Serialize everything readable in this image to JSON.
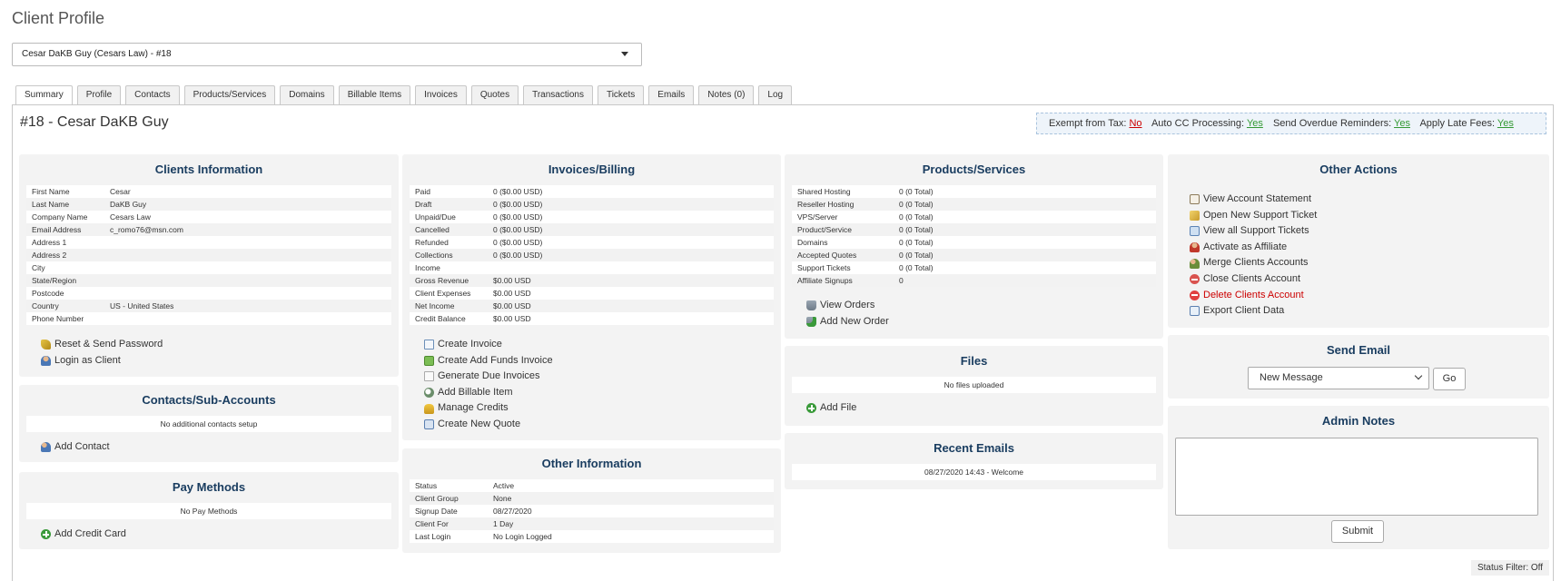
{
  "page": {
    "title": "Client Profile"
  },
  "client_selector": {
    "value": "Cesar DaKB Guy (Cesars Law) - #18"
  },
  "tabs": [
    {
      "label": "Summary",
      "active": true
    },
    {
      "label": "Profile"
    },
    {
      "label": "Contacts"
    },
    {
      "label": "Products/Services"
    },
    {
      "label": "Domains"
    },
    {
      "label": "Billable Items"
    },
    {
      "label": "Invoices"
    },
    {
      "label": "Quotes"
    },
    {
      "label": "Transactions"
    },
    {
      "label": "Tickets"
    },
    {
      "label": "Emails"
    },
    {
      "label": "Notes (0)"
    },
    {
      "label": "Log"
    }
  ],
  "client_heading": "#18 - Cesar DaKB Guy",
  "flags": {
    "exempt_label": "Exempt from Tax:",
    "exempt_value": "No",
    "autocc_label": "Auto CC Processing:",
    "autocc_value": "Yes",
    "overdue_label": "Send Overdue Reminders:",
    "overdue_value": "Yes",
    "latefees_label": "Apply Late Fees:",
    "latefees_value": "Yes"
  },
  "clients_info": {
    "title": "Clients Information",
    "rows": [
      {
        "k": "First Name",
        "v": "Cesar"
      },
      {
        "k": "Last Name",
        "v": "DaKB Guy"
      },
      {
        "k": "Company Name",
        "v": "Cesars Law"
      },
      {
        "k": "Email Address",
        "v": "c_romo76@msn.com"
      },
      {
        "k": "Address 1",
        "v": ""
      },
      {
        "k": "Address 2",
        "v": ""
      },
      {
        "k": "City",
        "v": ""
      },
      {
        "k": "State/Region",
        "v": ""
      },
      {
        "k": "Postcode",
        "v": ""
      },
      {
        "k": "Country",
        "v": "US - United States"
      },
      {
        "k": "Phone Number",
        "v": ""
      }
    ],
    "links": {
      "reset": "Reset & Send Password",
      "login": "Login as Client"
    }
  },
  "contacts": {
    "title": "Contacts/Sub-Accounts",
    "empty": "No additional contacts setup",
    "add": "Add Contact"
  },
  "pay_methods": {
    "title": "Pay Methods",
    "empty": "No Pay Methods",
    "add": "Add Credit Card"
  },
  "invoices": {
    "title": "Invoices/Billing",
    "rows": [
      {
        "k": "Paid",
        "v": "0 ($0.00 USD)"
      },
      {
        "k": "Draft",
        "v": "0 ($0.00 USD)"
      },
      {
        "k": "Unpaid/Due",
        "v": "0 ($0.00 USD)"
      },
      {
        "k": "Cancelled",
        "v": "0 ($0.00 USD)"
      },
      {
        "k": "Refunded",
        "v": "0 ($0.00 USD)"
      },
      {
        "k": "Collections",
        "v": "0 ($0.00 USD)"
      },
      {
        "k": "Income",
        "v": ""
      },
      {
        "k": "Gross Revenue",
        "v": "$0.00 USD"
      },
      {
        "k": "Client Expenses",
        "v": "$0.00 USD"
      },
      {
        "k": "Net Income",
        "v": "$0.00 USD"
      },
      {
        "k": "Credit Balance",
        "v": "$0.00 USD"
      }
    ],
    "links": {
      "create_invoice": "Create Invoice",
      "add_funds": "Create Add Funds Invoice",
      "generate_due": "Generate Due Invoices",
      "billable": "Add Billable Item",
      "credits": "Manage Credits",
      "quote": "Create New Quote"
    }
  },
  "other_info": {
    "title": "Other Information",
    "rows": [
      {
        "k": "Status",
        "v": "Active"
      },
      {
        "k": "Client Group",
        "v": "None"
      },
      {
        "k": "Signup Date",
        "v": "08/27/2020"
      },
      {
        "k": "Client For",
        "v": "1 Day"
      },
      {
        "k": "Last Login",
        "v": "No Login Logged"
      }
    ]
  },
  "products": {
    "title": "Products/Services",
    "rows": [
      {
        "k": "Shared Hosting",
        "v": "0 (0 Total)"
      },
      {
        "k": "Reseller Hosting",
        "v": "0 (0 Total)"
      },
      {
        "k": "VPS/Server",
        "v": "0 (0 Total)"
      },
      {
        "k": "Product/Service",
        "v": "0 (0 Total)"
      },
      {
        "k": "Domains",
        "v": "0 (0 Total)"
      },
      {
        "k": "Accepted Quotes",
        "v": "0 (0 Total)"
      },
      {
        "k": "Support Tickets",
        "v": "0 (0 Total)"
      },
      {
        "k": "Affiliate Signups",
        "v": "0"
      }
    ],
    "links": {
      "view_orders": "View Orders",
      "add_order": "Add New Order"
    }
  },
  "files": {
    "title": "Files",
    "empty": "No files uploaded",
    "add": "Add File"
  },
  "recent_emails": {
    "title": "Recent Emails",
    "item": "08/27/2020 14:43 - Welcome"
  },
  "other_actions": {
    "title": "Other Actions",
    "links": {
      "statement": "View Account Statement",
      "new_ticket": "Open New Support Ticket",
      "all_tickets": "View all Support Tickets",
      "affiliate": "Activate as Affiliate",
      "merge": "Merge Clients Accounts",
      "close": "Close Clients Account",
      "delete": "Delete Clients Account",
      "export": "Export Client Data"
    }
  },
  "send_email": {
    "title": "Send Email",
    "selected": "New Message",
    "go": "Go"
  },
  "admin_notes": {
    "title": "Admin Notes",
    "submit": "Submit"
  },
  "status_filter": "Status Filter: Off",
  "colors": {
    "heading": "#1a3d60",
    "danger": "#cc0000",
    "positive": "#339933"
  }
}
